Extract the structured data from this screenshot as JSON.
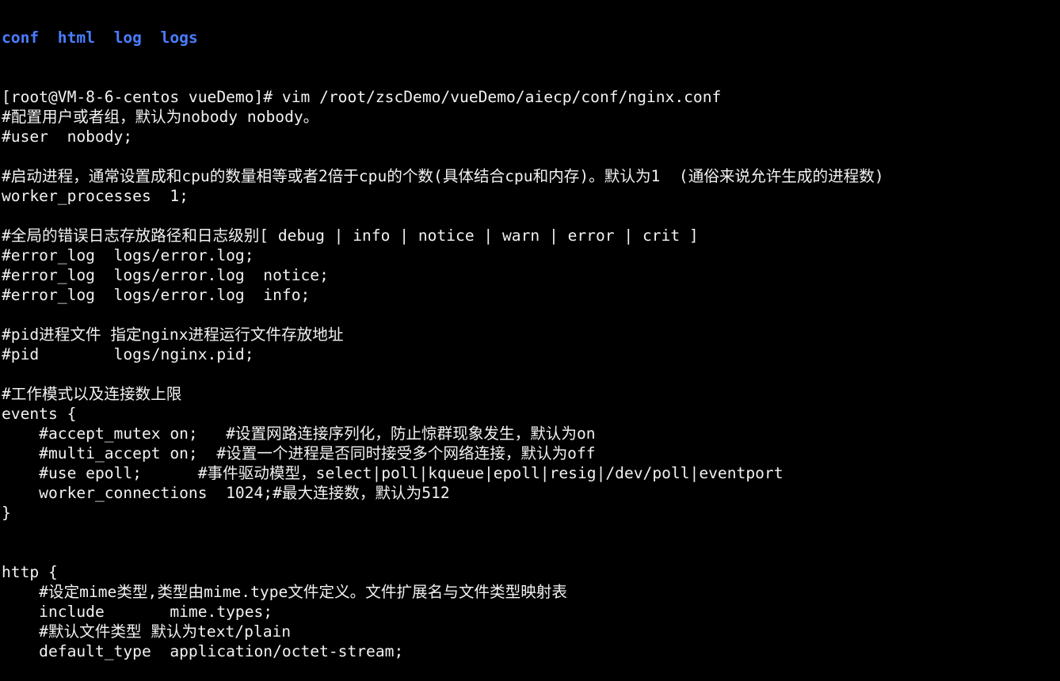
{
  "terminal": {
    "ls_output": [
      "conf",
      "html",
      "log",
      "logs"
    ],
    "dir_color": "#4a7dff",
    "lines": [
      "[root@VM-8-6-centos vueDemo]# vim /root/zscDemo/vueDemo/aiecp/conf/nginx.conf",
      "#配置用户或者组，默认为nobody nobody。",
      "#user  nobody;",
      "",
      "#启动进程，通常设置成和cpu的数量相等或者2倍于cpu的个数(具体结合cpu和内存)。默认为1  (通俗来说允许生成的进程数)",
      "worker_processes  1;",
      "",
      "#全局的错误日志存放路径和日志级别[ debug | info | notice | warn | error | crit ]",
      "#error_log  logs/error.log;",
      "#error_log  logs/error.log  notice;",
      "#error_log  logs/error.log  info;",
      "",
      "#pid进程文件 指定nginx进程运行文件存放地址",
      "#pid        logs/nginx.pid;",
      "",
      "#工作模式以及连接数上限",
      "events {",
      "    #accept_mutex on;   #设置网路连接序列化，防止惊群现象发生，默认为on",
      "    #multi_accept on;  #设置一个进程是否同时接受多个网络连接，默认为off",
      "    #use epoll;      #事件驱动模型，select|poll|kqueue|epoll|resig|/dev/poll|eventport",
      "    worker_connections  1024;#最大连接数，默认为512",
      "}",
      "",
      "",
      "http {",
      "    #设定mime类型,类型由mime.type文件定义。文件扩展名与文件类型映射表",
      "    include       mime.types;",
      "    #默认文件类型 默认为text/plain",
      "    default_type  application/octet-stream;"
    ]
  }
}
